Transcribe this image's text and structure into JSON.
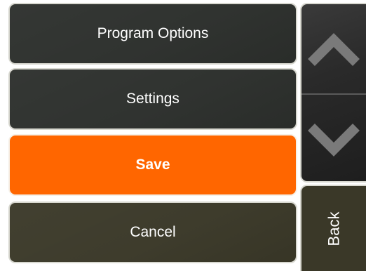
{
  "menu": {
    "program_options_label": "Program Options",
    "settings_label": "Settings",
    "save_label": "Save",
    "cancel_label": "Cancel"
  },
  "side": {
    "scroll_up_icon": "chevron-up-icon",
    "scroll_down_icon": "chevron-down-icon",
    "back_label": "Back"
  },
  "colors": {
    "dark_button": "#2c2f2c",
    "save_accent": "#ff6600",
    "cancel_button": "#3a3828",
    "chevron": "#7a7a7a"
  }
}
